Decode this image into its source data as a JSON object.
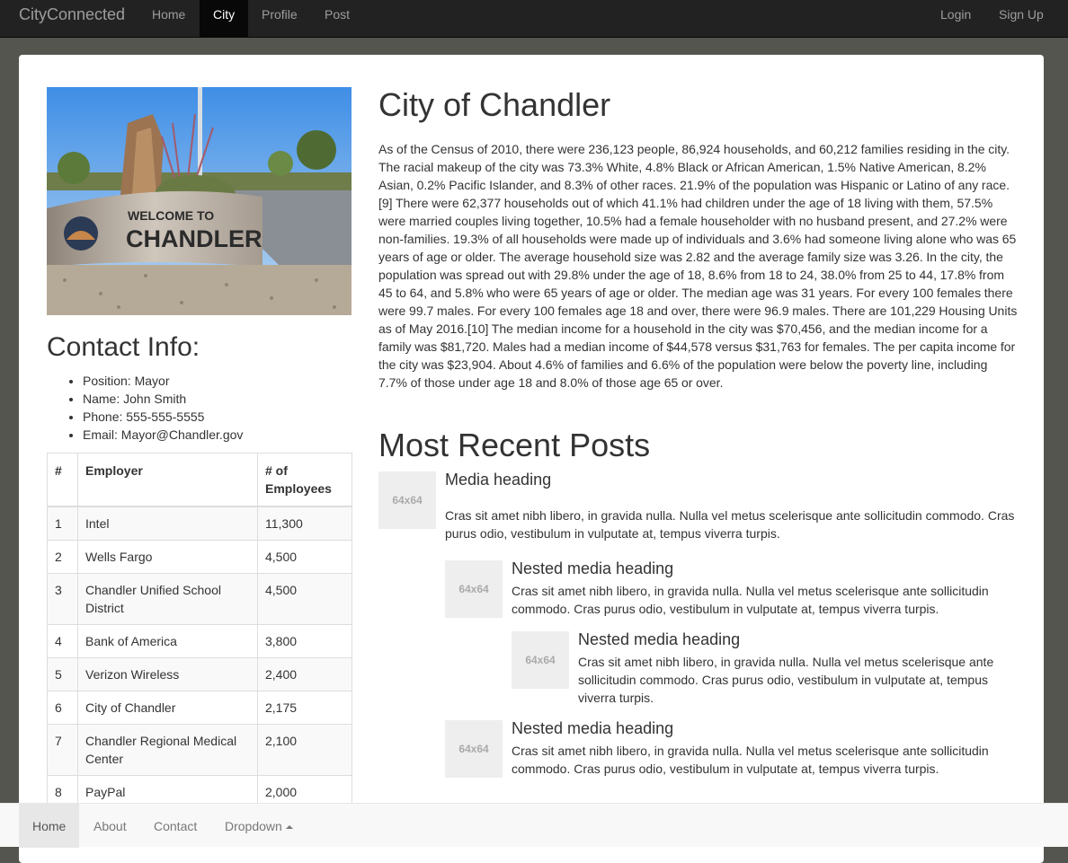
{
  "navbar": {
    "brand": "CityConnected",
    "links": [
      "Home",
      "City",
      "Profile",
      "Post"
    ],
    "active": "City",
    "right_links": [
      "Login",
      "Sign Up"
    ]
  },
  "photo": {
    "sign_line1": "WELCOME TO",
    "sign_line2": "CHANDLER"
  },
  "contact": {
    "title": "Contact Info:",
    "items": [
      "Position: Mayor",
      "Name: John Smith",
      "Phone: 555-555-5555",
      "Email: Mayor@Chandler.gov"
    ]
  },
  "employers": {
    "headers": [
      "#",
      "Employer",
      "# of Employees"
    ],
    "rows": [
      [
        "1",
        "Intel",
        "11,300"
      ],
      [
        "2",
        "Wells Fargo",
        "4,500"
      ],
      [
        "3",
        "Chandler Unified School District",
        "4,500"
      ],
      [
        "4",
        "Bank of America",
        "3,800"
      ],
      [
        "5",
        "Verizon Wireless",
        "2,400"
      ],
      [
        "6",
        "City of Chandler",
        "2,175"
      ],
      [
        "7",
        "Chandler Regional Medical Center",
        "2,100"
      ],
      [
        "8",
        "PayPal",
        "2,000"
      ]
    ]
  },
  "city": {
    "title": "City of Chandler",
    "description": "As of the Census of 2010, there were 236,123 people, 86,924 households, and 60,212 families residing in the city. The racial makeup of the city was 73.3% White, 4.8% Black or African American, 1.5% Native American, 8.2% Asian, 0.2% Pacific Islander, and 8.3% of other races. 21.9% of the population was Hispanic or Latino of any race.[9] There were 62,377 households out of which 41.1% had children under the age of 18 living with them, 57.5% were married couples living together, 10.5% had a female householder with no husband present, and 27.2% were non-families. 19.3% of all households were made up of individuals and 3.6% had someone living alone who was 65 years of age or older. The average household size was 2.82 and the average family size was 3.26. In the city, the population was spread out with 29.8% under the age of 18, 8.6% from 18 to 24, 38.0% from 25 to 44, 17.8% from 45 to 64, and 5.8% who were 65 years of age or older. The median age was 31 years. For every 100 females there were 99.7 males. For every 100 females age 18 and over, there were 96.9 males. There are 101,229 Housing Units as of May 2016.[10] The median income for a household in the city was $70,456, and the median income for a family was $81,720. Males had a median income of $44,578 versus $31,763 for females. The per capita income for the city was $23,904. About 4.6% of families and 6.6% of the population were below the poverty line, including 7.7% of those under age 18 and 8.0% of those age 65 or over."
  },
  "posts": {
    "title": "Most Recent Posts",
    "thumb_label": "64x64",
    "media": [
      {
        "heading": "Media heading",
        "body": "Cras sit amet nibh libero, in gravida nulla. Nulla vel metus scelerisque ante sollicitudin commodo. Cras purus odio, vestibulum in vulputate at, tempus viverra turpis."
      },
      {
        "heading": "Nested media heading",
        "body": "Cras sit amet nibh libero, in gravida nulla. Nulla vel metus scelerisque ante sollicitudin commodo. Cras purus odio, vestibulum in vulputate at, tempus viverra turpis."
      },
      {
        "heading": "Nested media heading",
        "body": "Cras sit amet nibh libero, in gravida nulla. Nulla vel metus scelerisque ante sollicitudin commodo. Cras purus odio, vestibulum in vulputate at, tempus viverra turpis."
      },
      {
        "heading": "Nested media heading",
        "body": "Cras sit amet nibh libero, in gravida nulla. Nulla vel metus scelerisque ante sollicitudin commodo. Cras purus odio, vestibulum in vulputate at, tempus viverra turpis."
      }
    ]
  },
  "footer_nav": {
    "links": [
      "Home",
      "About",
      "Contact",
      "Dropdown"
    ],
    "active": "Home"
  },
  "colors": {
    "navbar_bg": "#222222",
    "page_bg": "#54554f",
    "panel_bg": "#ffffff",
    "footer_bg": "#f8f8f8",
    "thumb_bg": "#eeeeee"
  }
}
